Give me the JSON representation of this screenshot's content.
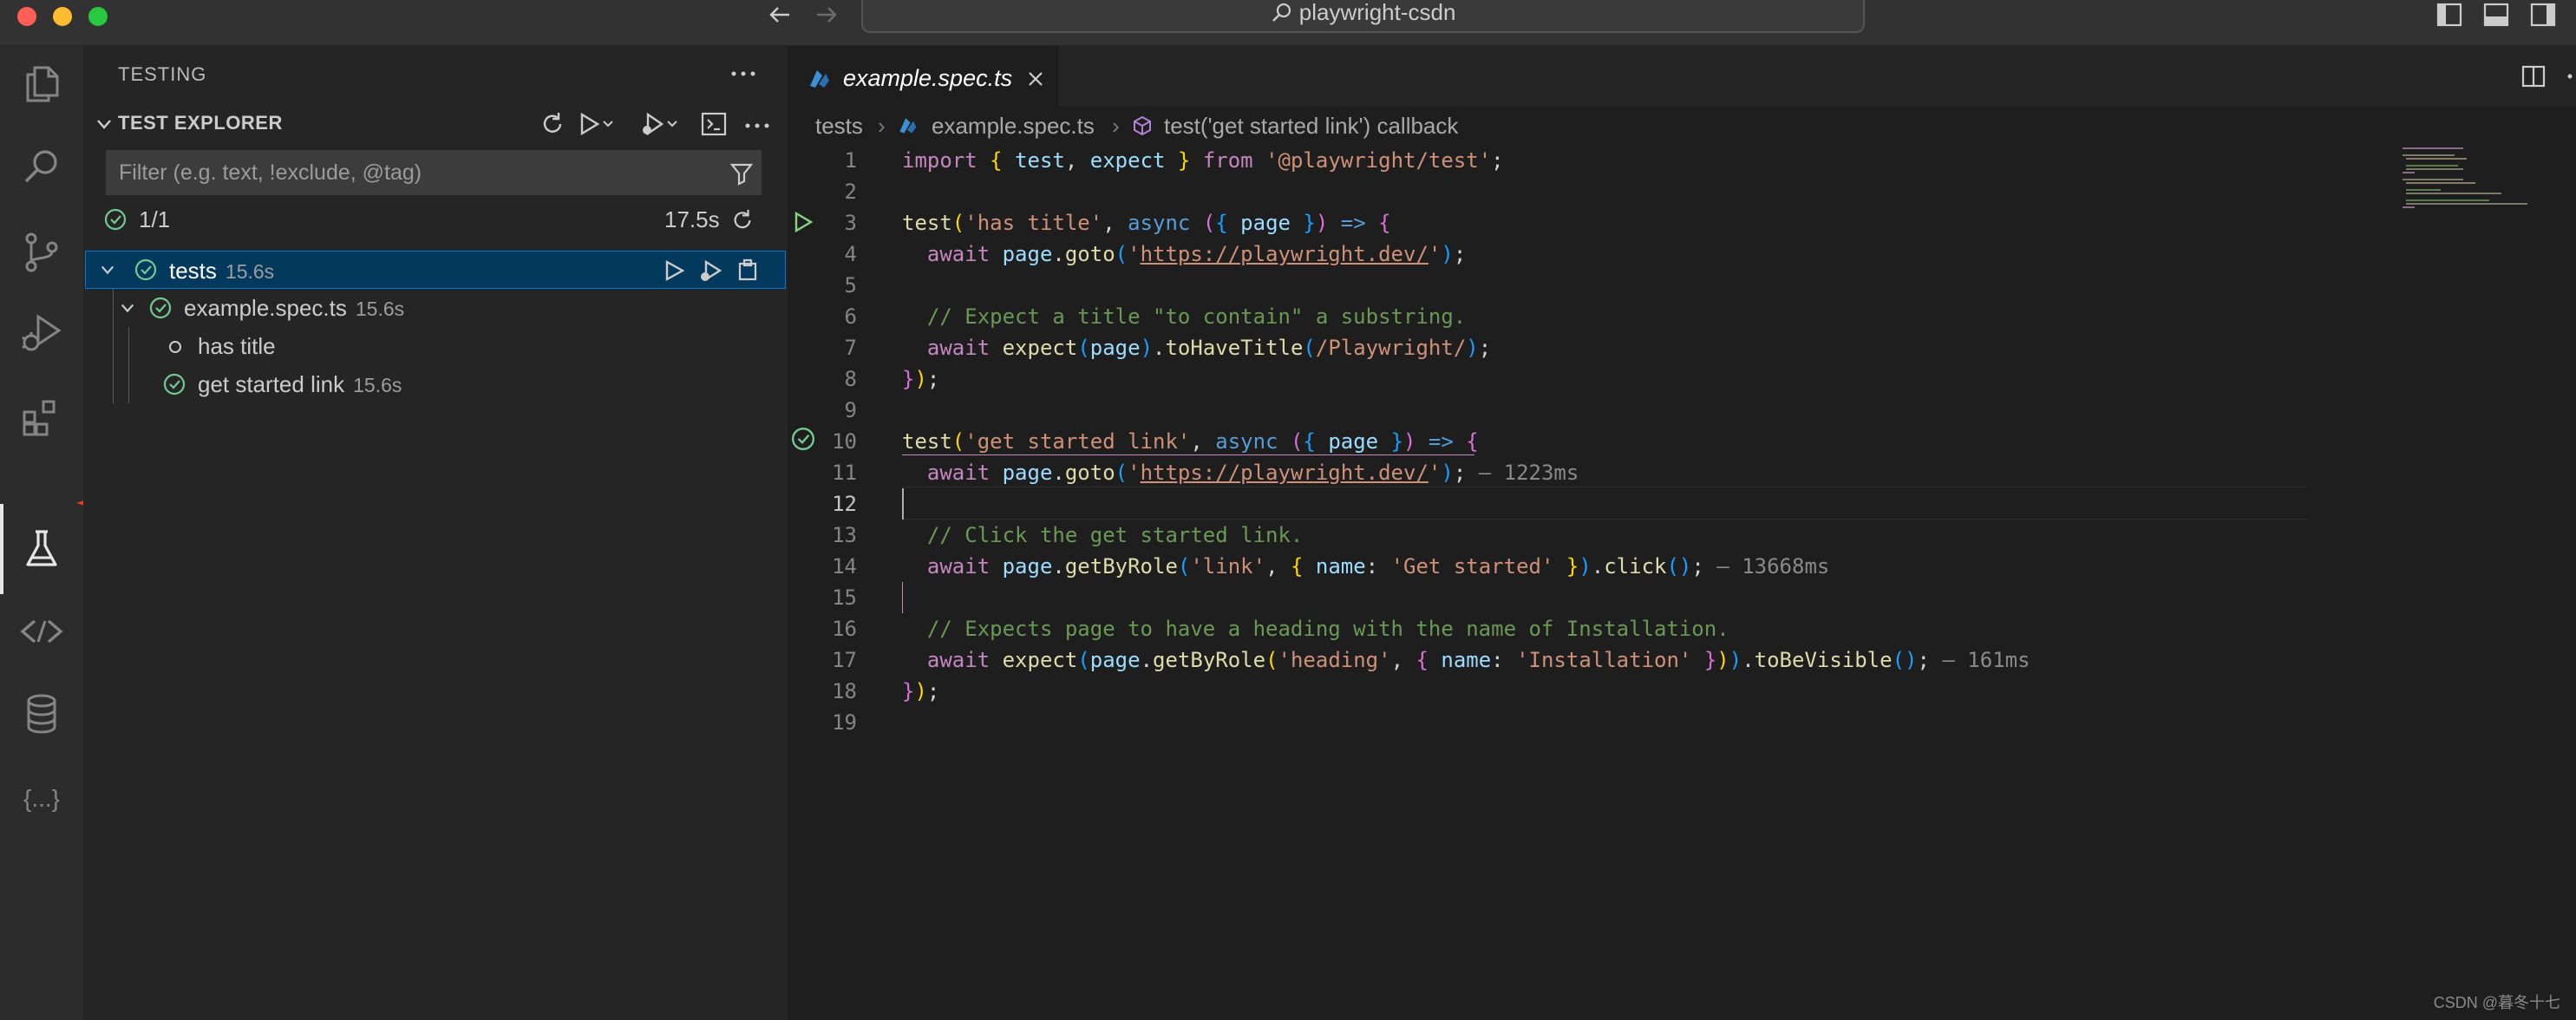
{
  "window": {
    "title": "playwright-csdn",
    "traffic_colors": [
      "#ff5f57",
      "#febc2e",
      "#28c840"
    ]
  },
  "activity_bar": {
    "items": [
      "files-icon",
      "search-icon",
      "source-control-icon",
      "run-debug-icon",
      "extensions-icon",
      "testing-icon",
      "remote-icon",
      "database-icon",
      "json-icon"
    ],
    "active": "testing-icon",
    "json_glyph": "{...}"
  },
  "sidebar": {
    "header": "TESTING",
    "section_title": "TEST EXPLORER",
    "filter_placeholder": "Filter (e.g. text, !exclude, @tag)",
    "summary": {
      "count": "1/1",
      "time": "17.5s"
    },
    "tree": [
      {
        "label": "tests",
        "duration": "15.6s",
        "status": "passed",
        "selected": true
      },
      {
        "label": "example.spec.ts",
        "duration": "15.6s",
        "status": "passed"
      },
      {
        "label": "has title",
        "duration": "",
        "status": "not-run"
      },
      {
        "label": "get started link",
        "duration": "15.6s",
        "status": "passed"
      }
    ]
  },
  "editor": {
    "tab": {
      "label": "example.spec.ts"
    },
    "breadcrumb": [
      "tests",
      "example.spec.ts",
      "test('get started link') callback"
    ],
    "line_numbers": [
      "1",
      "2",
      "3",
      "4",
      "5",
      "6",
      "7",
      "8",
      "9",
      "10",
      "11",
      "12",
      "13",
      "14",
      "15",
      "16",
      "17",
      "18",
      "19"
    ],
    "current_line": "12",
    "inline_hints": [
      "— 1223ms",
      "— 13668ms",
      "— 161ms"
    ],
    "code": {
      "l1_import": "import",
      "l1_test": "test",
      "l1_expect": "expect",
      "l1_from": "from",
      "l1_module": "'@playwright/test'",
      "test_fn": "test",
      "t1_name": "'has title'",
      "async": "async",
      "page": "page",
      "await": "await",
      "goto": "goto",
      "quote": "'",
      "url": "https://playwright.dev/",
      "comment_6": "// Expect a title \"to contain\" a substring.",
      "expect": "expect",
      "toHaveTitle": "toHaveTitle",
      "regex": "/Playwright/",
      "t2_name": "'get started link'",
      "comment_13": "// Click the get started link.",
      "getByRole": "getByRole",
      "link": "'link'",
      "name_key": "name",
      "get_started": "'Get started'",
      "click": "click",
      "comment_16": "// Expects page to have a heading with the name of Installation.",
      "heading": "'heading'",
      "installation": "'Installation'",
      "toBeVisible": "toBeVisible"
    }
  },
  "watermark": "CSDN @暮冬十七",
  "colors": {
    "accent": "#0078d4",
    "pass": "#73c991",
    "arrow": "#e8392a",
    "run": "#89d185"
  }
}
